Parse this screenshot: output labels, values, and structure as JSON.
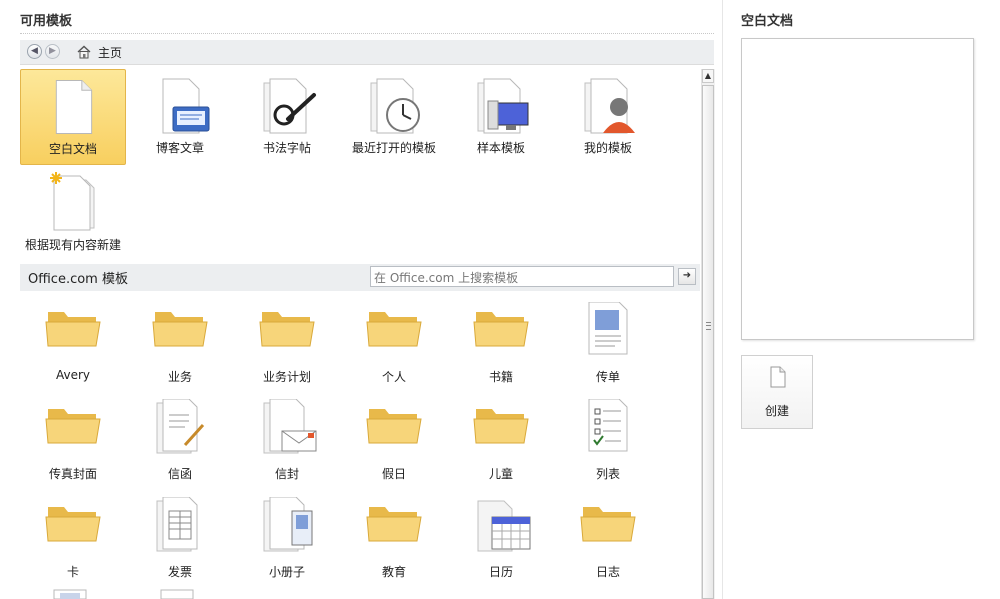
{
  "available": {
    "title": "可用模板",
    "breadcrumb": "主页",
    "top_items": [
      {
        "label": "空白文档",
        "icon": "blank-document-icon",
        "selected": true
      },
      {
        "label": "博客文章",
        "icon": "blog-post-icon"
      },
      {
        "label": "书法字帖",
        "icon": "calligraphy-icon"
      },
      {
        "label": "最近打开的模板",
        "icon": "recent-templates-icon"
      },
      {
        "label": "样本模板",
        "icon": "sample-templates-icon"
      },
      {
        "label": "我的模板",
        "icon": "my-templates-icon"
      },
      {
        "label": "根据现有内容新建",
        "icon": "new-from-existing-icon"
      }
    ]
  },
  "office": {
    "title": "Office.com 模板",
    "search_placeholder": "在 Office.com 上搜索模板",
    "items": [
      {
        "label": "Avery",
        "icon": "folder-icon"
      },
      {
        "label": "业务",
        "icon": "folder-icon"
      },
      {
        "label": "业务计划",
        "icon": "folder-icon"
      },
      {
        "label": "个人",
        "icon": "folder-icon"
      },
      {
        "label": "书籍",
        "icon": "folder-icon"
      },
      {
        "label": "传单",
        "icon": "flyer-icon"
      },
      {
        "label": "传真封面",
        "icon": "folder-icon"
      },
      {
        "label": "信函",
        "icon": "letter-icon"
      },
      {
        "label": "信封",
        "icon": "envelope-icon"
      },
      {
        "label": "假日",
        "icon": "folder-icon"
      },
      {
        "label": "儿童",
        "icon": "folder-icon"
      },
      {
        "label": "列表",
        "icon": "checklist-icon"
      },
      {
        "label": "卡",
        "icon": "folder-icon"
      },
      {
        "label": "发票",
        "icon": "invoice-icon"
      },
      {
        "label": "小册子",
        "icon": "brochure-icon"
      },
      {
        "label": "教育",
        "icon": "folder-icon"
      },
      {
        "label": "日历",
        "icon": "calendar-icon"
      },
      {
        "label": "日志",
        "icon": "folder-icon"
      }
    ]
  },
  "preview": {
    "title": "空白文档",
    "create_label": "创建"
  }
}
